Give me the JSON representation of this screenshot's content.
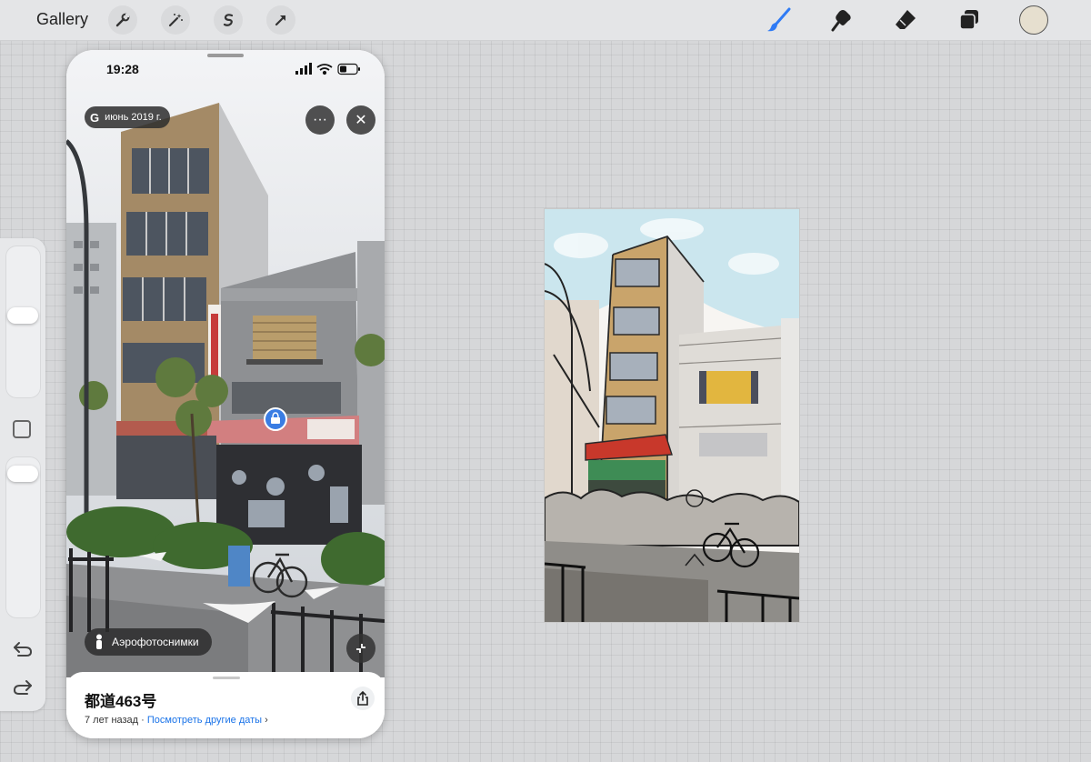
{
  "toolbar": {
    "gallery_label": "Gallery",
    "left_tools": [
      "wrench-icon",
      "magic-wand-icon",
      "selection-icon",
      "transform-arrow-icon"
    ],
    "right_tools": [
      "brush-icon",
      "smudge-icon",
      "eraser-icon",
      "layers-icon"
    ],
    "active_tool": "brush",
    "active_color": "#e6dfcf",
    "accent_color": "#2f7bf5"
  },
  "sidebar": {
    "brush_size_level": 0.55,
    "opacity_level": 0.95,
    "undo_icon": "undo-icon",
    "redo_icon": "redo-icon"
  },
  "reference": {
    "status": {
      "time": "19:28"
    },
    "date_pill": {
      "logo": "G",
      "label": "июнь 2019 г."
    },
    "more_label": "···",
    "close_label": "✕",
    "aerial_label": "Аэрофотоснимки",
    "place": {
      "title": "都道463号",
      "ago": "7 лет назад",
      "separator": "·",
      "link": "Посмотреть другие даты",
      "chevron": "›"
    }
  }
}
